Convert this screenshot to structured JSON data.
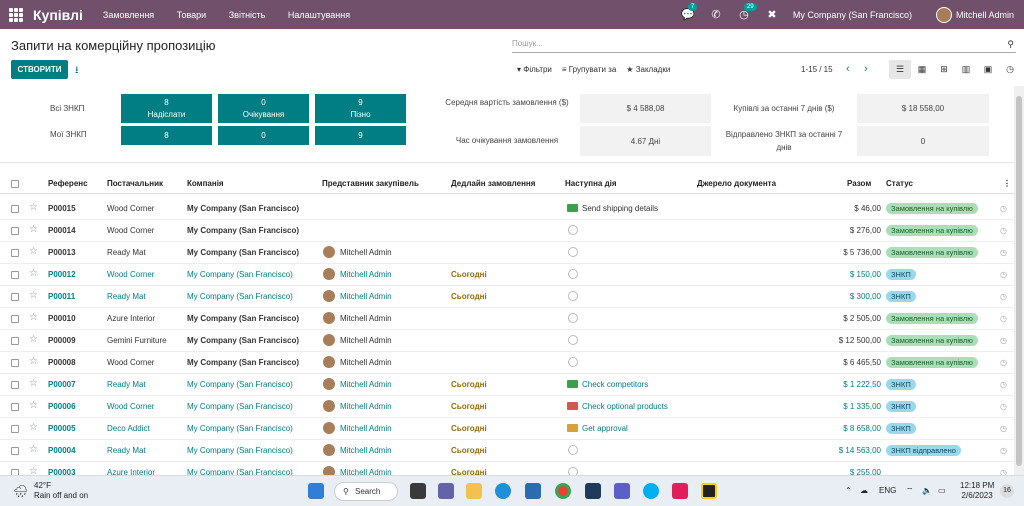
{
  "topbar": {
    "app_name": "Купівлі",
    "menu": [
      "Замовлення",
      "Товари",
      "Звітність",
      "Налаштування"
    ],
    "chat_badge": "7",
    "activity_badge": "29",
    "company": "My Company (San Francisco)",
    "user": "Mitchell Admin"
  },
  "page": {
    "title": "Запити на комерційну пропозицію",
    "search_placeholder": "Пошук...",
    "create_label": "СТВОРИТИ",
    "filters_label": "Фільтри",
    "group_label": "Групувати за",
    "favorites_label": "Закладки",
    "pager": "1-15 / 15"
  },
  "dashboard": {
    "all_label": "Всі ЗНКП",
    "my_label": "Мої ЗНКП",
    "tiles": [
      {
        "count": "8",
        "label": "Надіслати",
        "my": "8"
      },
      {
        "count": "0",
        "label": "Очікування",
        "my": "0"
      },
      {
        "count": "9",
        "label": "Пізно",
        "my": "9"
      }
    ],
    "avg_label": "Середня вартість замовлення ($)",
    "avg_value": "$ 4 588,08",
    "lead_label": "Час очікування замовлення",
    "lead_value": "4.67  Дні",
    "purchased_label": "Купівлі за останні 7 днів ($)",
    "purchased_value": "$ 18 558,00",
    "sent_label": "Відправлено ЗНКП за останні 7 днів",
    "sent_value": "0"
  },
  "table": {
    "headers": {
      "reference": "Референс",
      "vendor": "Постачальник",
      "company": "Компанія",
      "buyer": "Представник закупівель",
      "deadline": "Дедлайн замовлення",
      "activity": "Наступна дія",
      "source": "Джерело документа",
      "total": "Разом",
      "status": "Статус"
    },
    "rows": [
      {
        "ref": "P00015",
        "vendor": "Wood Corner",
        "company": "My Company (San Francisco)",
        "buyer": "",
        "deadline": "",
        "activity": "Send shipping details",
        "act_color": "#3aa34a",
        "total": "$ 46,00",
        "status": "Замовлення на купівлю",
        "kind": "po",
        "highlight": false
      },
      {
        "ref": "P00014",
        "vendor": "Wood Corner",
        "company": "My Company (San Francisco)",
        "buyer": "",
        "deadline": "",
        "activity": "",
        "act_color": "",
        "total": "$ 276,00",
        "status": "Замовлення на купівлю",
        "kind": "po",
        "highlight": false
      },
      {
        "ref": "P00013",
        "vendor": "Ready Mat",
        "company": "My Company (San Francisco)",
        "buyer": "Mitchell Admin",
        "deadline": "",
        "activity": "",
        "act_color": "",
        "total": "$ 5 736,00",
        "status": "Замовлення на купівлю",
        "kind": "po",
        "highlight": false
      },
      {
        "ref": "P00012",
        "vendor": "Wood Corner",
        "company": "My Company (San Francisco)",
        "buyer": "Mitchell Admin",
        "deadline": "Сьогодні",
        "activity": "",
        "act_color": "",
        "total": "$ 150,00",
        "status": "ЗНКП",
        "kind": "rfq",
        "highlight": true
      },
      {
        "ref": "P00011",
        "vendor": "Ready Mat",
        "company": "My Company (San Francisco)",
        "buyer": "Mitchell Admin",
        "deadline": "Сьогодні",
        "activity": "",
        "act_color": "",
        "total": "$ 300,00",
        "status": "ЗНКП",
        "kind": "rfq",
        "highlight": true
      },
      {
        "ref": "P00010",
        "vendor": "Azure Interior",
        "company": "My Company (San Francisco)",
        "buyer": "Mitchell Admin",
        "deadline": "",
        "activity": "",
        "act_color": "",
        "total": "$ 2 505,00",
        "status": "Замовлення на купівлю",
        "kind": "po",
        "highlight": false
      },
      {
        "ref": "P00009",
        "vendor": "Gemini Furniture",
        "company": "My Company (San Francisco)",
        "buyer": "Mitchell Admin",
        "deadline": "",
        "activity": "",
        "act_color": "",
        "total": "$ 12 500,00",
        "status": "Замовлення на купівлю",
        "kind": "po",
        "highlight": false
      },
      {
        "ref": "P00008",
        "vendor": "Wood Corner",
        "company": "My Company (San Francisco)",
        "buyer": "Mitchell Admin",
        "deadline": "",
        "activity": "",
        "act_color": "",
        "total": "$ 6 465,50",
        "status": "Замовлення на купівлю",
        "kind": "po",
        "highlight": false
      },
      {
        "ref": "P00007",
        "vendor": "Ready Mat",
        "company": "My Company (San Francisco)",
        "buyer": "Mitchell Admin",
        "deadline": "Сьогодні",
        "activity": "Check competitors",
        "act_color": "#3aa34a",
        "total": "$ 1 222,50",
        "status": "ЗНКП",
        "kind": "rfq",
        "highlight": true
      },
      {
        "ref": "P00006",
        "vendor": "Wood Corner",
        "company": "My Company (San Francisco)",
        "buyer": "Mitchell Admin",
        "deadline": "Сьогодні",
        "activity": "Check optional products",
        "act_color": "#d9534f",
        "total": "$ 1 335,00",
        "status": "ЗНКП",
        "kind": "rfq",
        "highlight": true
      },
      {
        "ref": "P00005",
        "vendor": "Deco Addict",
        "company": "My Company (San Francisco)",
        "buyer": "Mitchell Admin",
        "deadline": "Сьогодні",
        "activity": "Get approval",
        "act_color": "#d9a03a",
        "total": "$ 8 658,00",
        "status": "ЗНКП",
        "kind": "rfq",
        "highlight": true
      },
      {
        "ref": "P00004",
        "vendor": "Ready Mat",
        "company": "My Company (San Francisco)",
        "buyer": "Mitchell Admin",
        "deadline": "Сьогодні",
        "activity": "",
        "act_color": "",
        "total": "$ 14 563,00",
        "status": "ЗНКП відправлено",
        "kind": "rfq",
        "highlight": true
      },
      {
        "ref": "P00003",
        "vendor": "Azure Interior",
        "company": "My Company (San Francisco)",
        "buyer": "Mitchell Admin",
        "deadline": "Сьогодні",
        "activity": "",
        "act_color": "",
        "total": "$ 255,00",
        "status": "",
        "kind": "rfq",
        "highlight": true
      }
    ]
  },
  "taskbar": {
    "temp": "42°F",
    "weather": "Rain off and on",
    "search": "Search",
    "lang": "ENG",
    "time": "12:18 PM",
    "date": "2/6/2023",
    "notif": "16"
  }
}
